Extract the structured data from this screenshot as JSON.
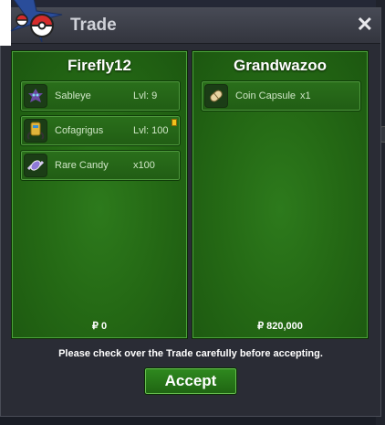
{
  "window": {
    "title": "Trade",
    "close_label": "✕"
  },
  "left": {
    "player": "Firefly12",
    "items": [
      {
        "name": "Sableye",
        "value": "Lvl: 9",
        "icon": "sableye-icon"
      },
      {
        "name": "Cofagrigus",
        "value": "Lvl: 100",
        "icon": "cofagrigus-icon"
      },
      {
        "name": "Rare Candy",
        "value": "x100",
        "icon": "rare-candy-icon"
      }
    ],
    "money": "₽ 0"
  },
  "right": {
    "player": "Grandwazoo",
    "items": [
      {
        "name": "Coin Capsule",
        "value": "x1",
        "icon": "coin-capsule-icon"
      }
    ],
    "money": "₽ 820,000"
  },
  "notice": "Please check over the Trade carefully before accepting.",
  "accept_label": "Accept",
  "colors": {
    "panel": "#256a15",
    "accent": "#f2c21b"
  }
}
